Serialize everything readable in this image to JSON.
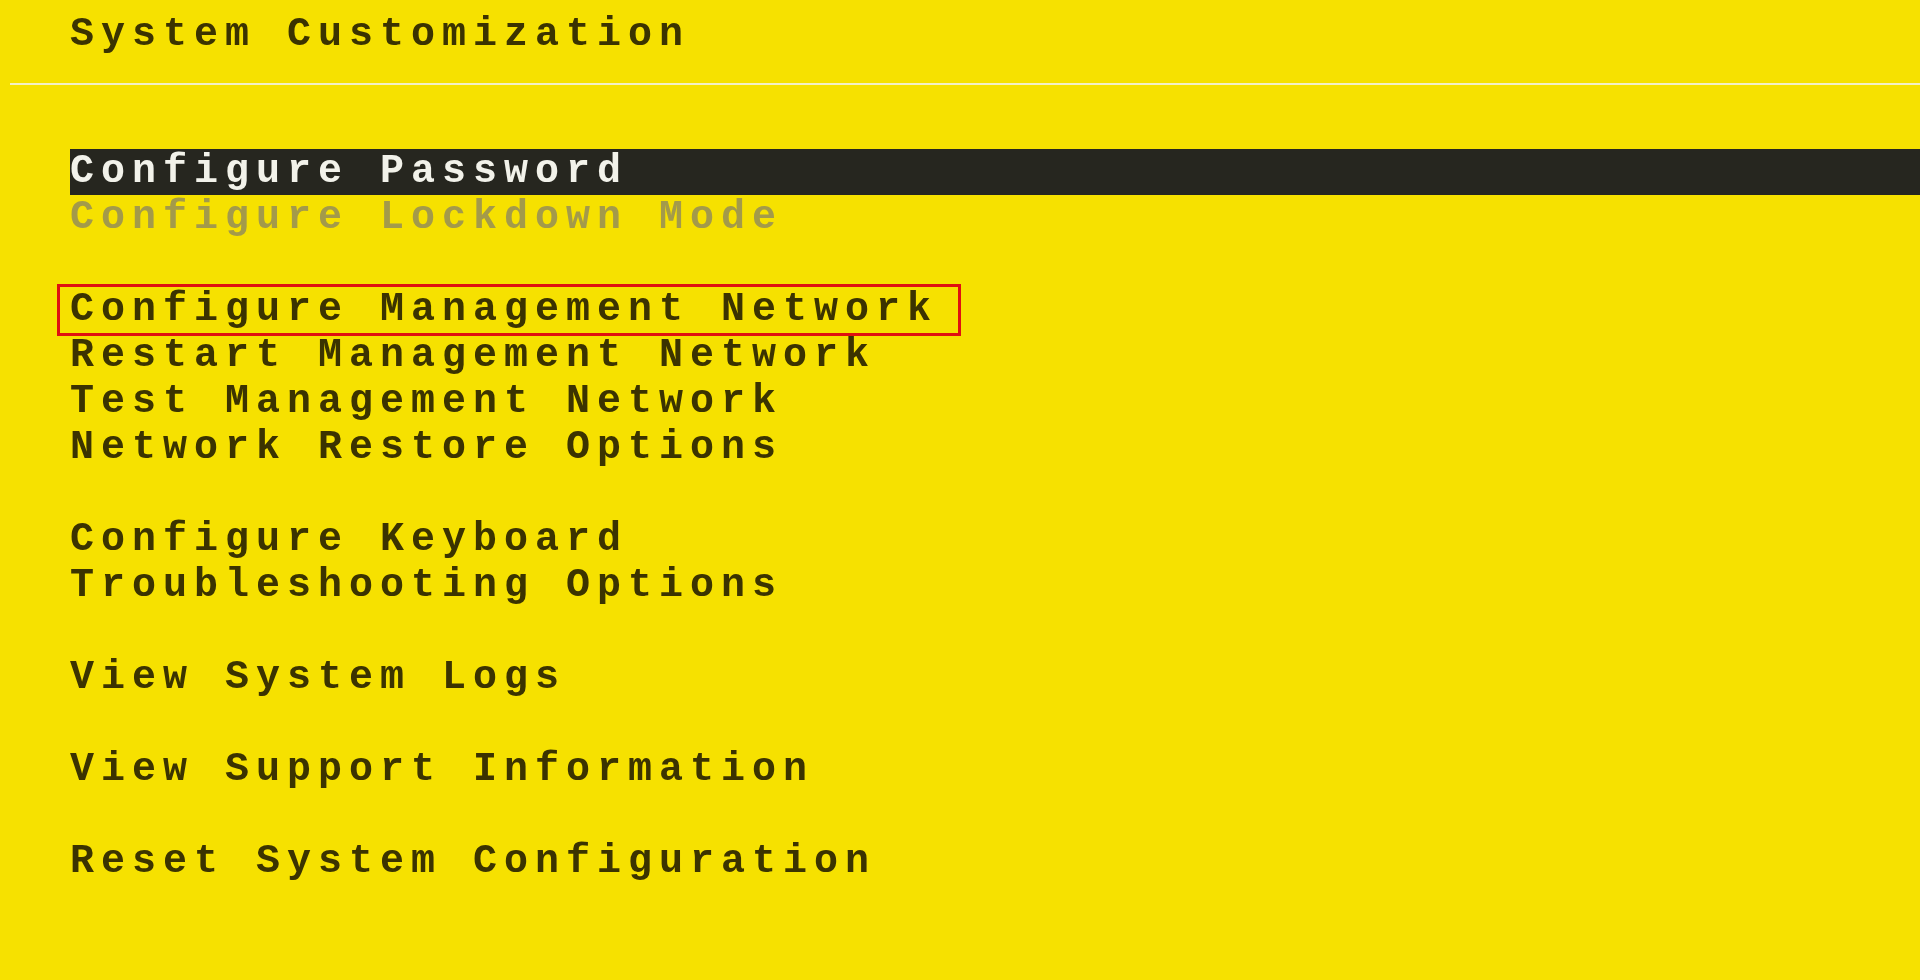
{
  "title": "System Customization",
  "groups": [
    {
      "items": [
        {
          "label": "Configure Password",
          "selected": true,
          "disabled": false,
          "outlined": false
        },
        {
          "label": "Configure Lockdown Mode",
          "selected": false,
          "disabled": true,
          "outlined": false
        }
      ]
    },
    {
      "items": [
        {
          "label": "Configure Management Network",
          "selected": false,
          "disabled": false,
          "outlined": true
        },
        {
          "label": "Restart Management Network",
          "selected": false,
          "disabled": false,
          "outlined": false
        },
        {
          "label": "Test Management Network",
          "selected": false,
          "disabled": false,
          "outlined": false
        },
        {
          "label": "Network Restore Options",
          "selected": false,
          "disabled": false,
          "outlined": false
        }
      ]
    },
    {
      "items": [
        {
          "label": "Configure Keyboard",
          "selected": false,
          "disabled": false,
          "outlined": false
        },
        {
          "label": "Troubleshooting Options",
          "selected": false,
          "disabled": false,
          "outlined": false
        }
      ]
    },
    {
      "items": [
        {
          "label": "View System Logs",
          "selected": false,
          "disabled": false,
          "outlined": false
        }
      ]
    },
    {
      "items": [
        {
          "label": "View Support Information",
          "selected": false,
          "disabled": false,
          "outlined": false
        }
      ]
    },
    {
      "items": [
        {
          "label": "Reset System Configuration",
          "selected": false,
          "disabled": false,
          "outlined": false
        }
      ]
    }
  ]
}
